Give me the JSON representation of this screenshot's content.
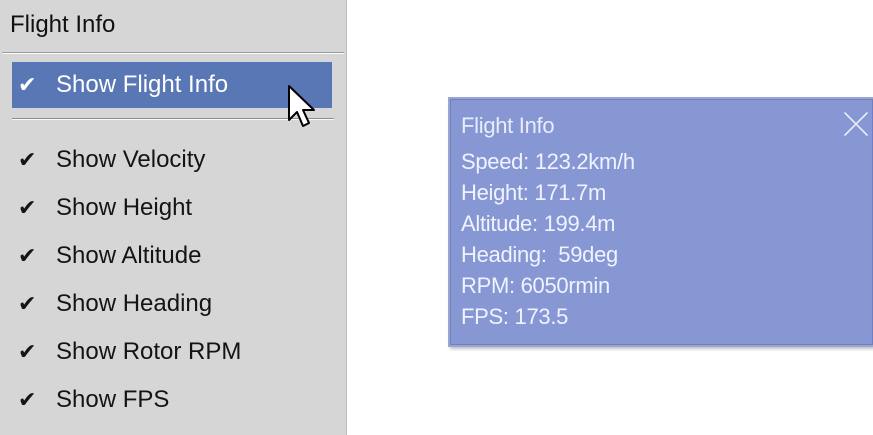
{
  "menu": {
    "title": "Flight Info",
    "items": [
      {
        "label": "Show Flight Info",
        "checked": true,
        "selected": true
      },
      {
        "label": "Show Velocity",
        "checked": true
      },
      {
        "label": "Show Height",
        "checked": true
      },
      {
        "label": "Show Altitude",
        "checked": true
      },
      {
        "label": "Show Heading",
        "checked": true
      },
      {
        "label": "Show Rotor RPM",
        "checked": true
      },
      {
        "label": "Show FPS",
        "checked": true
      }
    ],
    "check_glyph": "✔",
    "highlight_color": "#5a77b5"
  },
  "panel": {
    "title": "Flight Info",
    "close_icon": "close-x-icon",
    "background_color": "#8697d4",
    "lines": [
      "Speed: 123.2km/h",
      "Height: 171.7m",
      "Altitude: 199.4m",
      "Heading:  59deg",
      "RPM: 6050rmin",
      "FPS: 173.5"
    ]
  }
}
